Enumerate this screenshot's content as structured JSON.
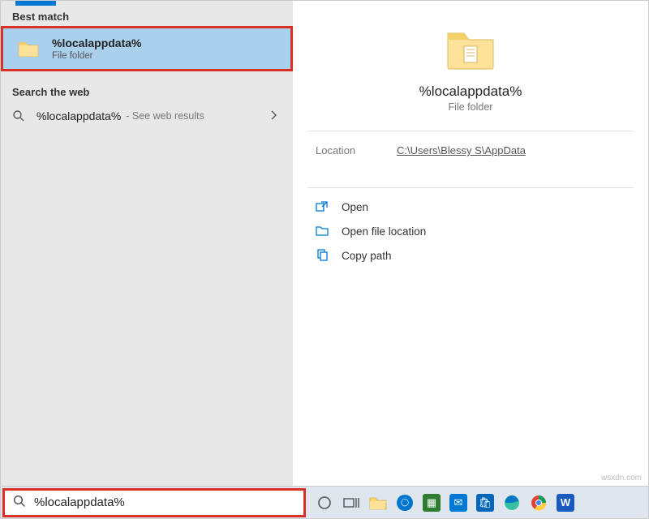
{
  "left": {
    "section_header": "Best match",
    "result": {
      "title": "%localappdata%",
      "subtitle": "File folder"
    },
    "web_header": "Search the web",
    "web": {
      "title": "%localappdata%",
      "suffix": " - See web results"
    }
  },
  "preview": {
    "title": "%localappdata%",
    "subtitle": "File folder",
    "location_label": "Location",
    "location_value": "C:\\Users\\Blessy S\\AppData",
    "actions": {
      "open": "Open",
      "open_loc": "Open file location",
      "copy_path": "Copy path"
    }
  },
  "searchbox": {
    "value": "%localappdata%"
  },
  "watermark": "wsxdn.com"
}
